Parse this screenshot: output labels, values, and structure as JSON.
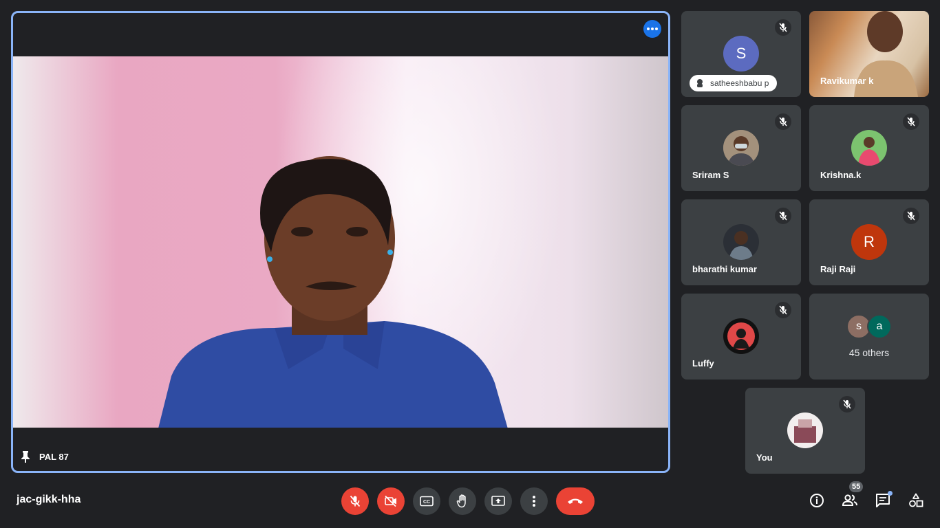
{
  "meeting": {
    "code": "jac-gikk-hha"
  },
  "main_speaker": {
    "name": "PAL 87"
  },
  "participants": [
    {
      "name": "satheeshbabu p",
      "initial": "S",
      "avatar_color": "#5c6bc0"
    },
    {
      "name": "Ravikumar k"
    },
    {
      "name": "Sriram S"
    },
    {
      "name": "Krishna.k"
    },
    {
      "name": "bharathi kumar"
    },
    {
      "name": "Raji Raji",
      "initial": "R",
      "avatar_color": "#bf360c"
    },
    {
      "name": "Luffy"
    }
  ],
  "others": {
    "initials": [
      "s",
      "a"
    ],
    "colors": [
      "#8d6e63",
      "#00695c"
    ],
    "label": "45 others"
  },
  "self": {
    "name": "You"
  },
  "toolbar": {
    "people_count": "55"
  },
  "colors": {
    "background": "#202124",
    "tile": "#3c4043",
    "accent": "#8ab4f8",
    "danger": "#ea4335"
  }
}
